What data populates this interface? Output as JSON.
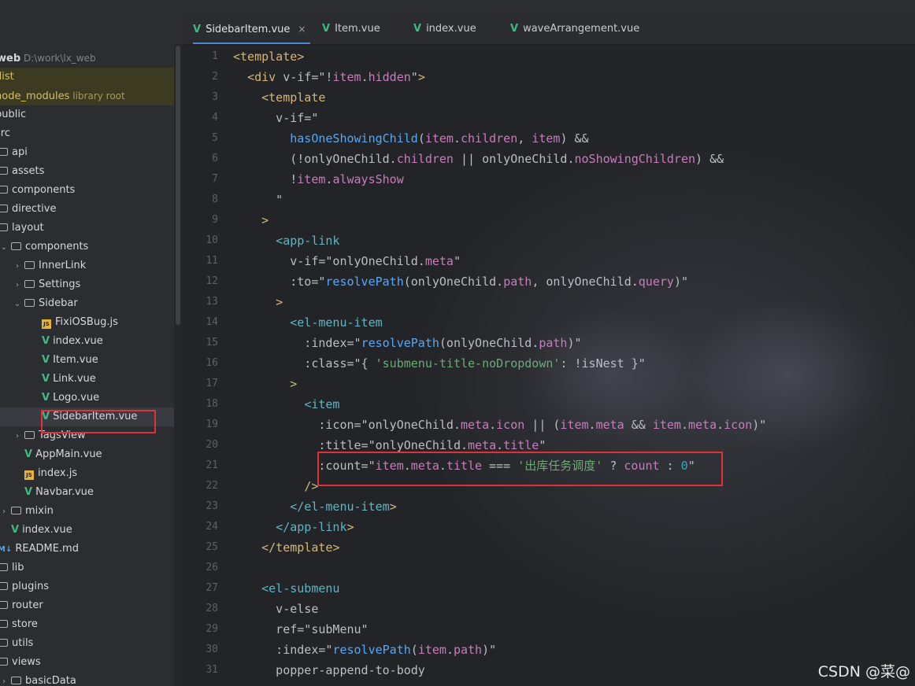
{
  "project": {
    "name": "web",
    "path": "D:\\work\\lx_web"
  },
  "tree": [
    {
      "label": "web",
      "hint": "D:\\work\\lx_web",
      "type": "root",
      "indent": 0,
      "chev": "",
      "style": "bold"
    },
    {
      "label": "dist",
      "type": "folder",
      "indent": 0,
      "chev": "",
      "style": "hl-yellow"
    },
    {
      "label": "node_modules",
      "hint": "library root",
      "type": "folder",
      "indent": 0,
      "chev": "",
      "style": "hl-yellow"
    },
    {
      "label": "public",
      "type": "folder",
      "indent": 0,
      "chev": ""
    },
    {
      "label": "src",
      "type": "folder",
      "indent": 0,
      "chev": ""
    },
    {
      "label": "api",
      "type": "folder",
      "indent": 1,
      "chev": ""
    },
    {
      "label": "assets",
      "type": "folder",
      "indent": 1,
      "chev": ""
    },
    {
      "label": "components",
      "type": "folder",
      "indent": 1,
      "chev": ""
    },
    {
      "label": "directive",
      "type": "folder",
      "indent": 1,
      "chev": ""
    },
    {
      "label": "layout",
      "type": "folder",
      "indent": 1,
      "chev": ""
    },
    {
      "label": "components",
      "type": "folder",
      "indent": 2,
      "chev": "v"
    },
    {
      "label": "InnerLink",
      "type": "folder",
      "indent": 3,
      "chev": ">"
    },
    {
      "label": "Settings",
      "type": "folder",
      "indent": 3,
      "chev": ">"
    },
    {
      "label": "Sidebar",
      "type": "folder",
      "indent": 3,
      "chev": "v"
    },
    {
      "label": "FixiOSBug.js",
      "type": "js",
      "indent": 4,
      "chev": ""
    },
    {
      "label": "index.vue",
      "type": "vue",
      "indent": 4,
      "chev": ""
    },
    {
      "label": "Item.vue",
      "type": "vue",
      "indent": 4,
      "chev": ""
    },
    {
      "label": "Link.vue",
      "type": "vue",
      "indent": 4,
      "chev": ""
    },
    {
      "label": "Logo.vue",
      "type": "vue",
      "indent": 4,
      "chev": ""
    },
    {
      "label": "SidebarItem.vue",
      "type": "vue",
      "indent": 4,
      "chev": "",
      "style": "selected"
    },
    {
      "label": "TagsView",
      "type": "folder",
      "indent": 3,
      "chev": ">"
    },
    {
      "label": "AppMain.vue",
      "type": "vue",
      "indent": 3,
      "chev": ""
    },
    {
      "label": "index.js",
      "type": "js",
      "indent": 3,
      "chev": ""
    },
    {
      "label": "Navbar.vue",
      "type": "vue",
      "indent": 3,
      "chev": ""
    },
    {
      "label": "mixin",
      "type": "folder",
      "indent": 2,
      "chev": ">"
    },
    {
      "label": "index.vue",
      "type": "vue",
      "indent": 2,
      "chev": ""
    },
    {
      "label": "README.md",
      "type": "md",
      "indent": 1,
      "chev": ""
    },
    {
      "label": "lib",
      "type": "folder",
      "indent": 1,
      "chev": ""
    },
    {
      "label": "plugins",
      "type": "folder",
      "indent": 1,
      "chev": ""
    },
    {
      "label": "router",
      "type": "folder",
      "indent": 1,
      "chev": ""
    },
    {
      "label": "store",
      "type": "folder",
      "indent": 1,
      "chev": ""
    },
    {
      "label": "utils",
      "type": "folder",
      "indent": 1,
      "chev": ""
    },
    {
      "label": "views",
      "type": "folder",
      "indent": 1,
      "chev": ""
    },
    {
      "label": "basicData",
      "type": "folder",
      "indent": 2,
      "chev": ">"
    }
  ],
  "tabs": [
    {
      "label": "SidebarItem.vue",
      "active": true,
      "closable": true
    },
    {
      "label": "Item.vue",
      "active": false
    },
    {
      "label": "index.vue",
      "active": false
    },
    {
      "label": "waveArrangement.vue",
      "active": false
    }
  ],
  "code": [
    "<template>",
    "  <div v-if=\"!item.hidden\">",
    "    <template",
    "      v-if=\"",
    "        hasOneShowingChild(item.children, item) &&",
    "        (!onlyOneChild.children || onlyOneChild.noShowingChildren) &&",
    "        !item.alwaysShow",
    "      \"",
    "    >",
    "      <app-link",
    "        v-if=\"onlyOneChild.meta\"",
    "        :to=\"resolvePath(onlyOneChild.path, onlyOneChild.query)\"",
    "      >",
    "        <el-menu-item",
    "          :index=\"resolvePath(onlyOneChild.path)\"",
    "          :class=\"{ 'submenu-title-noDropdown': !isNest }\"",
    "        >",
    "          <item",
    "            :icon=\"onlyOneChild.meta.icon || (item.meta && item.meta.icon)\"",
    "            :title=\"onlyOneChild.meta.title\"",
    "            :count=\"item.meta.title === '出库任务调度' ? count : 0\"",
    "          />",
    "        </el-menu-item>",
    "      </app-link>",
    "    </template>",
    "",
    "    <el-submenu",
    "      v-else",
    "      ref=\"subMenu\"",
    "      :index=\"resolvePath(item.path)\"",
    "      popper-append-to-body"
  ],
  "watermark": "CSDN @菜@",
  "colors": {
    "accent": "#4a88d8",
    "highlight_box": "#e0313a",
    "vue_icon": "#41b883"
  }
}
